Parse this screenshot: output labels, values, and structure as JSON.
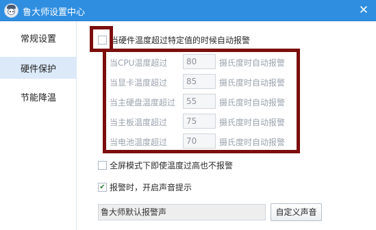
{
  "window": {
    "title": "鲁大师设置中心",
    "close_glyph": "✕"
  },
  "sidebar": {
    "items": [
      {
        "label": "常规设置",
        "active": false
      },
      {
        "label": "硬件保护",
        "active": true
      },
      {
        "label": "节能降温",
        "active": false
      }
    ]
  },
  "hardware_protection": {
    "alarm_checkbox_label": "当硬件温度超过特定值的时候自动报警",
    "alarm_checked": false,
    "rows": [
      {
        "label": "当CPU温度超过",
        "value": "80",
        "unit": "摄氏度时自动报警"
      },
      {
        "label": "当显卡温度超过",
        "value": "85",
        "unit": "摄氏度时自动报警"
      },
      {
        "label": "当主硬盘温度超过",
        "value": "55",
        "unit": "摄氏度时自动报警"
      },
      {
        "label": "当主板温度超过",
        "value": "75",
        "unit": "摄氏度时自动报警"
      },
      {
        "label": "当电池温度超过",
        "value": "70",
        "unit": "摄氏度时自动报警"
      }
    ],
    "fullscreen_label": "全屏模式下即使温度过高也不报警",
    "fullscreen_checked": false,
    "sound_label": "报警时，开启声音提示",
    "sound_checked": true,
    "check_glyph": "✔",
    "sound_select_value": "鲁大师默认报警声",
    "custom_sound_button": "自定义声音"
  },
  "colors": {
    "titlebar": "#2f8ee0",
    "highlight": "#7b0d0d",
    "sidebar_active": "#dbe9f8"
  }
}
